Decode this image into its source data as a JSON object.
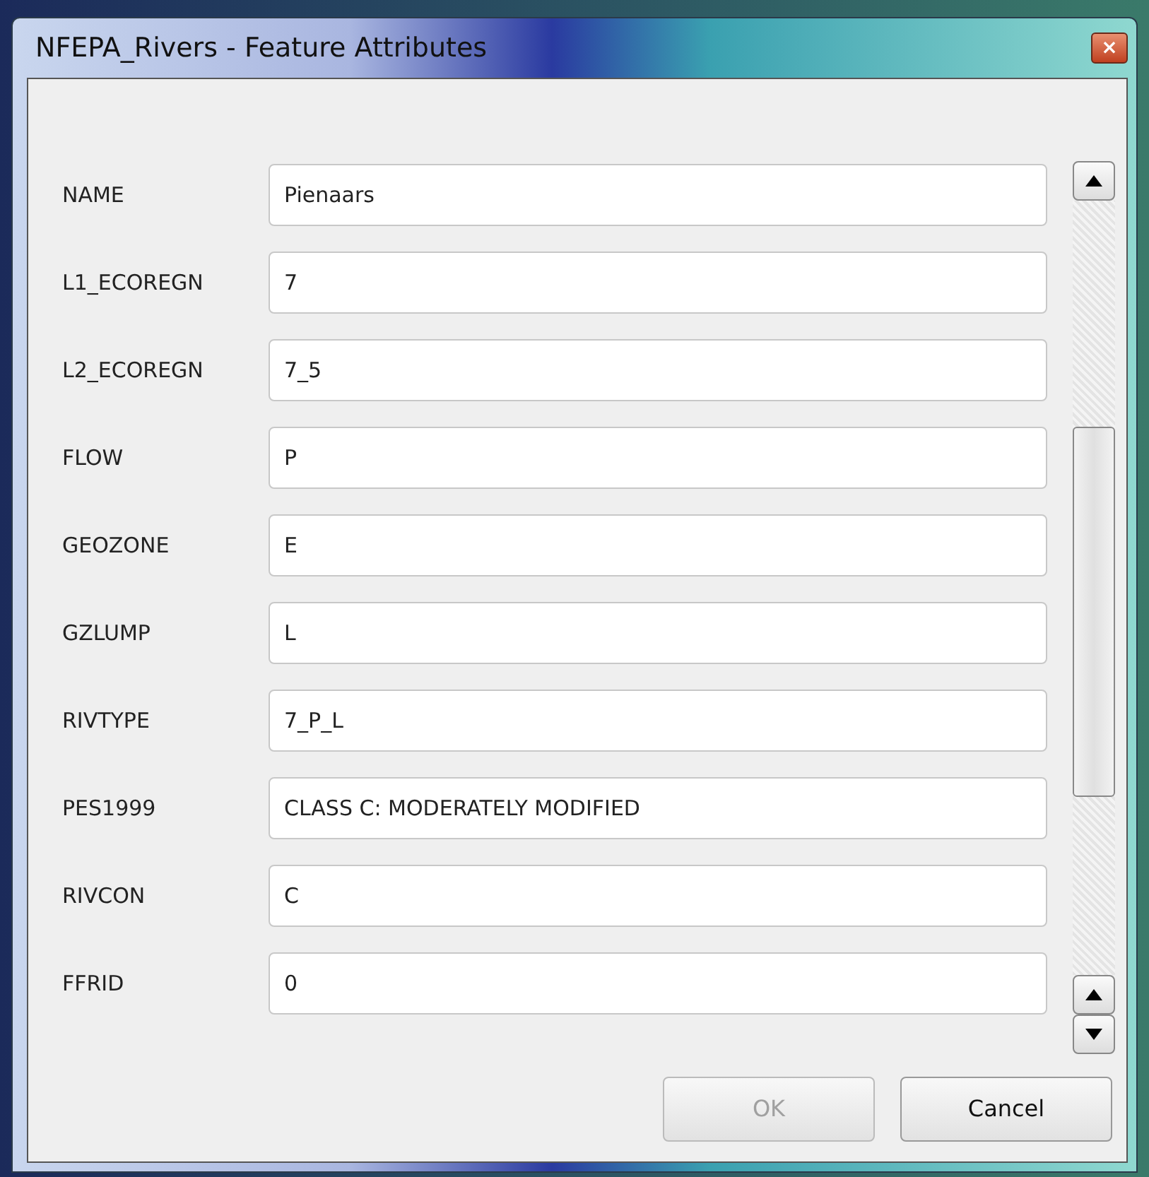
{
  "window": {
    "title": "NFEPA_Rivers - Feature Attributes",
    "close": "×"
  },
  "fields": [
    {
      "label": "NAME",
      "value": "Pienaars"
    },
    {
      "label": "L1_ECOREGN",
      "value": "7"
    },
    {
      "label": "L2_ECOREGN",
      "value": "7_5"
    },
    {
      "label": "FLOW",
      "value": "P"
    },
    {
      "label": "GEOZONE",
      "value": "E"
    },
    {
      "label": "GZLUMP",
      "value": "L"
    },
    {
      "label": "RIVTYPE",
      "value": "7_P_L"
    },
    {
      "label": "PES1999",
      "value": "CLASS C: MODERATELY MODIFIED"
    },
    {
      "label": "RIVCON",
      "value": "C"
    },
    {
      "label": "FFRID",
      "value": "0"
    }
  ],
  "buttons": [
    {
      "label": "OK",
      "disabled": true
    },
    {
      "label": "Cancel",
      "disabled": false
    }
  ]
}
